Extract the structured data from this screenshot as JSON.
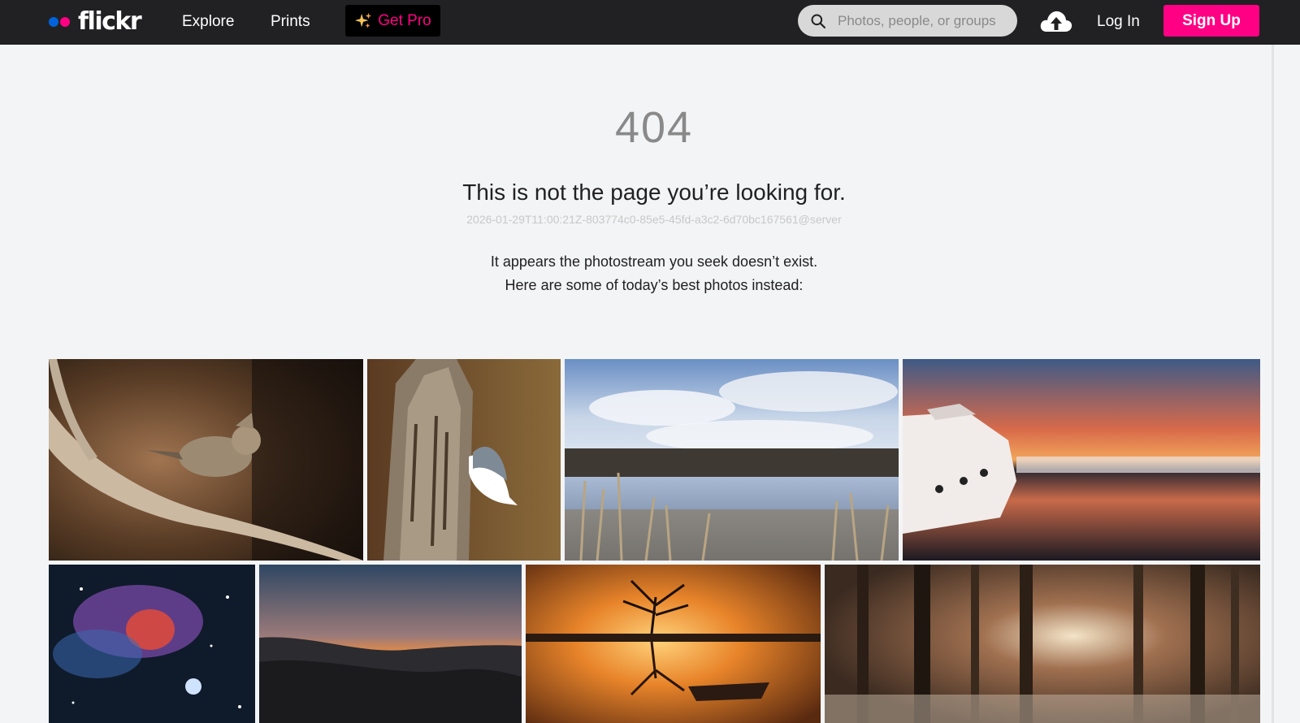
{
  "header": {
    "logo_text": "flickr",
    "nav": [
      {
        "label": "Explore"
      },
      {
        "label": "Prints"
      }
    ],
    "get_pro_label": "Get Pro",
    "search": {
      "placeholder": "Photos, people, or groups",
      "value": ""
    },
    "login_label": "Log In",
    "signup_label": "Sign Up"
  },
  "error": {
    "code": "404",
    "title": "This is not the page you’re looking for.",
    "request_id": "2026-01-29T11:00:21Z-803774c0-85e5-45fd-a3c2-6d70bc167561@server",
    "message_line1": "It appears the photostream you seek doesn’t exist.",
    "message_line2": "Here are some of today’s best photos instead:"
  },
  "colors": {
    "topbar": "#212124",
    "brand_blue": "#0063dc",
    "brand_pink": "#ff0084",
    "page_bg": "#f3f4f6"
  },
  "icons": [
    "search-icon",
    "upload-cloud-icon",
    "sparkle-icon"
  ]
}
